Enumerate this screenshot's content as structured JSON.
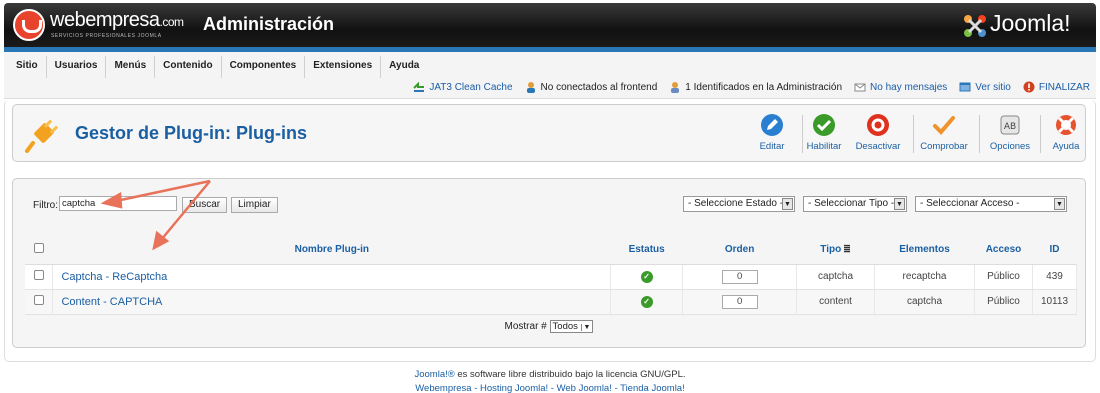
{
  "header": {
    "brand": "webempresa",
    "brand_domain": ".com",
    "brand_tagline": "SERVICIOS PROFESIONALES JOOMLA",
    "title": "Administración",
    "cms_name": "Joomla!"
  },
  "menu": {
    "items": [
      {
        "label": "Sitio"
      },
      {
        "label": "Usuarios"
      },
      {
        "label": "Menús"
      },
      {
        "label": "Contenido"
      },
      {
        "label": "Componentes"
      },
      {
        "label": "Extensiones"
      },
      {
        "label": "Ayuda"
      }
    ]
  },
  "status": {
    "cache": "JAT3 Clean Cache",
    "frontend": "No conectados al frontend",
    "admins": "1 Identificados en la Administración",
    "messages": "No hay mensajes",
    "view_site": "Ver sitio",
    "logout": "FINALIZAR"
  },
  "toolbar": {
    "page_title": "Gestor de Plug-in: Plug-ins",
    "edit": "Editar",
    "enable": "Habilitar",
    "disable": "Desactivar",
    "check": "Comprobar",
    "options": "Opciones",
    "help": "Ayuda"
  },
  "filter": {
    "label": "Filtro:",
    "value": "captcha",
    "search_button": "Buscar",
    "clear_button": "Limpiar",
    "state_select": "- Seleccione Estado -",
    "type_select": "- Seleccionar Tipo -",
    "access_select": "- Seleccionar Acceso -"
  },
  "table": {
    "headers": {
      "name": "Nombre Plug-in",
      "status": "Estatus",
      "order": "Orden",
      "type": "Tipo",
      "element": "Elementos",
      "access": "Acceso",
      "id": "ID"
    },
    "rows": [
      {
        "name": "Captcha - ReCaptcha",
        "order": "0",
        "type": "captcha",
        "element": "recaptcha",
        "access": "Público",
        "id": "439"
      },
      {
        "name": "Content - CAPTCHA",
        "order": "0",
        "type": "content",
        "element": "captcha",
        "access": "Público",
        "id": "10113"
      }
    ]
  },
  "pager": {
    "label": "Mostrar #",
    "value": "Todos"
  },
  "footer": {
    "line1_link": "Joomla!®",
    "line1_text": " es software libre distribuido bajo la licencia GNU/GPL.",
    "line2": "Webempresa - Hosting Joomla! - Web Joomla! - Tienda Joomla!"
  },
  "colors": {
    "accent_blue": "#1b5fa3",
    "annotation_arrow": "#e8735a",
    "header_bg": "#1b1b1b"
  }
}
